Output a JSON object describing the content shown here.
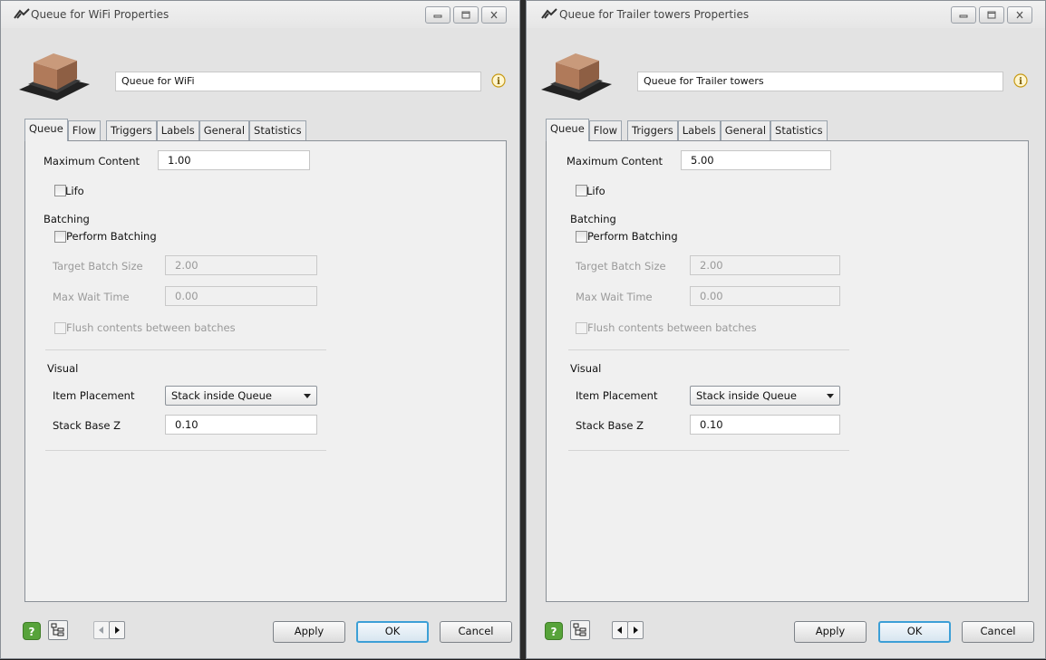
{
  "left": {
    "title": "Queue for WiFi  Properties",
    "name": "Queue for WiFi",
    "tabs": [
      "Queue",
      "Flow",
      "Triggers",
      "Labels",
      "General",
      "Statistics"
    ],
    "max_content_label": "Maximum Content",
    "max_content_value": "1.00",
    "lifo_label": "Lifo",
    "batching_label": "Batching",
    "perform_batching_label": "Perform Batching",
    "target_batch_label": "Target Batch Size",
    "target_batch_value": "2.00",
    "max_wait_label": "Max Wait Time",
    "max_wait_value": "0.00",
    "flush_label": "Flush contents between batches",
    "visual_label": "Visual",
    "item_placement_label": "Item Placement",
    "item_placement_value": "Stack inside Queue",
    "stack_base_label": "Stack Base Z",
    "stack_base_value": "0.10",
    "apply": "Apply",
    "ok": "OK",
    "cancel": "Cancel"
  },
  "right": {
    "title": "Queue for Trailer towers  Properties",
    "name": "Queue for Trailer towers",
    "tabs": [
      "Queue",
      "Flow",
      "Triggers",
      "Labels",
      "General",
      "Statistics"
    ],
    "max_content_label": "Maximum Content",
    "max_content_value": "5.00",
    "lifo_label": "Lifo",
    "batching_label": "Batching",
    "perform_batching_label": "Perform Batching",
    "target_batch_label": "Target Batch Size",
    "target_batch_value": "2.00",
    "max_wait_label": "Max Wait Time",
    "max_wait_value": "0.00",
    "flush_label": "Flush contents between batches",
    "visual_label": "Visual",
    "item_placement_label": "Item Placement",
    "item_placement_value": "Stack inside Queue",
    "stack_base_label": "Stack Base Z",
    "stack_base_value": "0.10",
    "apply": "Apply",
    "ok": "OK",
    "cancel": "Cancel"
  },
  "icons": {
    "app": "flexsim-logo-icon",
    "object": "queue-box-icon",
    "info": "info-icon",
    "help": "help-icon",
    "tree": "tree-view-icon",
    "prev": "arrow-left-icon",
    "next": "arrow-right-icon"
  },
  "colors": {
    "ok_border": "#3c9fd6",
    "help_green": "#57a33a",
    "info_gold": "#d4a11a"
  }
}
